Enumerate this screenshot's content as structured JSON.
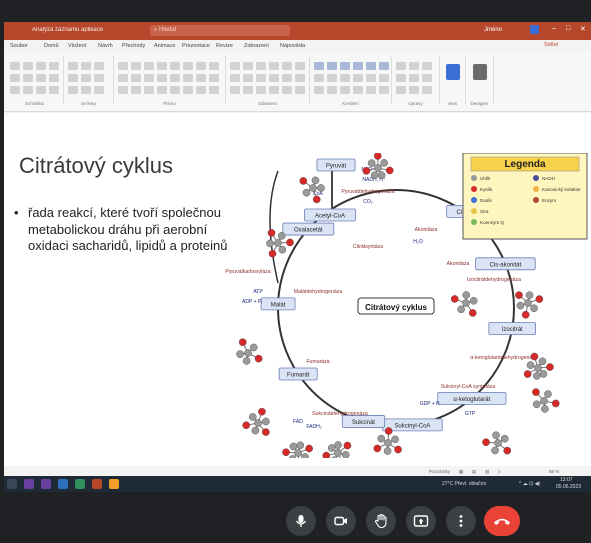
{
  "app": {
    "title": "Analýza záznamu aplikace",
    "search_text": "Hledat",
    "user_name": "Jméno",
    "share_label": "Sdílet"
  },
  "menu": {
    "items": [
      "Soubor",
      "Domů",
      "Vložení",
      "Návrh",
      "Přechody",
      "Animace",
      "Prezentace",
      "Revize",
      "Zobrazení",
      "Nápověda"
    ]
  },
  "ribbon": {
    "groups": [
      "Schránka",
      "Snímky",
      "Písmo",
      "Odstavec",
      "Kreslení",
      "Úpravy",
      "Hlas",
      "Designer"
    ]
  },
  "slide": {
    "title": "Citrátový cyklus",
    "bullet_marker": "•",
    "bullet_text": "řada reakcí, které tvoří společnou metabolickou dráhu při aerobní oxidaci sacharidů, lipidů a proteinů"
  },
  "diagram": {
    "center_label": "Citrátový cyklus",
    "legend_title": "Legenda",
    "nodes": [
      "Pyruvát",
      "Acetyl-CoA",
      "Citrát",
      "Cis-akonitát",
      "Izocitrát",
      "α-ketoglutarát",
      "Sukcinyl-CoA",
      "Sukcinát",
      "Fumarát",
      "Malát",
      "Oxalacetát"
    ],
    "enzymes": [
      "Pyruvátdehydrogenáza",
      "Citrátsyntáza",
      "Akonitáza",
      "Akonitáza",
      "Izocitrátdehydrogenáza",
      "α-ketoglutarátdehydrogenáza",
      "Sukcinyl-CoA syntetáza",
      "Sukcinátdehydrogenáza",
      "Fumaráza",
      "Malátdehydrogenáza",
      "Pyruvátkarboxyláza"
    ],
    "cofactors": [
      "CoA",
      "NAD⁺",
      "NADH, H⁺",
      "CO₂",
      "H₂O",
      "ATP",
      "ADP + Pᵢ",
      "FAD",
      "FADH₂",
      "GDP + Pᵢ",
      "GTP"
    ],
    "legend_items": [
      "Uhlík",
      "Kyslík",
      "Dusík",
      "Síra",
      "Koenzym Q",
      "NADH",
      "Kanonický kofaktor",
      "Enzym"
    ],
    "colors": {
      "node_fill": "#dbe4f5",
      "node_stroke": "#6b7fb8",
      "enzyme_text": "#8b2f2f",
      "legend_fill": "#fff5bf",
      "legend_title_bg": "#f6d34a",
      "oxygen": "#d62a2a",
      "carbon": "#9a9a9a"
    }
  },
  "status_bar": {
    "notes_label": "Poznámky",
    "zoom": "88 %"
  },
  "taskbar": {
    "weather": "27°C Převl. oblačno",
    "time": "13:07",
    "date": "05.06.2023"
  },
  "meeting_controls": {
    "icons": [
      "microphone-icon",
      "camera-icon",
      "raise-hand-icon",
      "present-screen-icon",
      "more-options-icon",
      "end-call-icon"
    ]
  }
}
